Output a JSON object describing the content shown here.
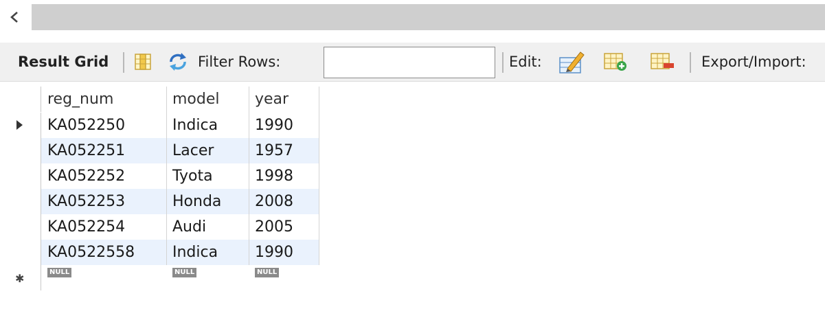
{
  "scroll": {
    "left_arrow": "<"
  },
  "toolbar": {
    "result_grid_label": "Result Grid",
    "filter_rows_label": "Filter Rows:",
    "filter_value": "",
    "edit_label": "Edit:",
    "export_import_label": "Export/Import:"
  },
  "grid": {
    "columns": [
      "reg_num",
      "model",
      "year"
    ],
    "rows": [
      [
        "KA052250",
        "Indica",
        "1990"
      ],
      [
        "KA052251",
        "Lacer",
        "1957"
      ],
      [
        "KA052252",
        "Tyota",
        "1998"
      ],
      [
        "KA052253",
        "Honda",
        "2008"
      ],
      [
        "KA052254",
        "Audi",
        "2005"
      ],
      [
        "KA0522558",
        "Indica",
        "1990"
      ]
    ],
    "new_row": [
      "NULL",
      "NULL",
      "NULL"
    ]
  },
  "colors": {
    "alt_row": "#eaf2fd",
    "toolbar_bg": "#f0f0f0",
    "scroll_track": "#cfcfcf"
  }
}
